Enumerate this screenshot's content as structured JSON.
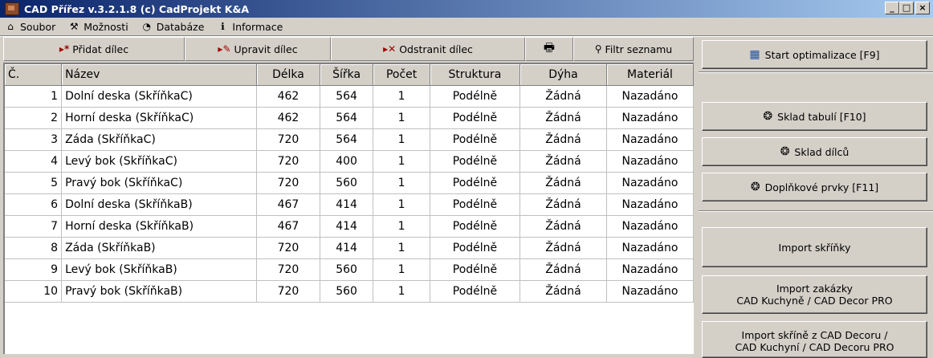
{
  "window": {
    "title": "CAD Přířez v.3.2.1.8  (c) CadProjekt K&A"
  },
  "window_buttons": {
    "minimize": "_",
    "maximize": "□",
    "close": "×"
  },
  "menu": [
    {
      "label": "Soubor",
      "icon": "home-icon",
      "glyph": "⌂"
    },
    {
      "label": "Možnosti",
      "icon": "tools-icon",
      "glyph": "⚒"
    },
    {
      "label": "Databáze",
      "icon": "database-icon",
      "glyph": "◔"
    },
    {
      "label": "Informace",
      "icon": "info-icon",
      "glyph": "ℹ"
    }
  ],
  "toolbar": {
    "add": "Přidat dílec",
    "edit": "Upravit dílec",
    "remove": "Odstranit dílec",
    "print_glyph": "🖶",
    "filter": "Filtr seznamu"
  },
  "table": {
    "headers": [
      "Č.",
      "Název",
      "Délka",
      "Šířka",
      "Počet",
      "Struktura",
      "Dýha",
      "Materiál"
    ],
    "rows": [
      [
        "1",
        "Dolní deska (SkříňkaC)",
        "462",
        "564",
        "1",
        "Podélně",
        "Žádná",
        "Nazadáno"
      ],
      [
        "2",
        "Horní deska (SkříňkaC)",
        "462",
        "564",
        "1",
        "Podélně",
        "Žádná",
        "Nazadáno"
      ],
      [
        "3",
        "Záda (SkříňkaC)",
        "720",
        "564",
        "1",
        "Podélně",
        "Žádná",
        "Nazadáno"
      ],
      [
        "4",
        "Levý bok (SkříňkaC)",
        "720",
        "400",
        "1",
        "Podélně",
        "Žádná",
        "Nazadáno"
      ],
      [
        "5",
        "Pravý bok (SkříňkaC)",
        "720",
        "560",
        "1",
        "Podélně",
        "Žádná",
        "Nazadáno"
      ],
      [
        "6",
        "Dolní deska (SkříňkaB)",
        "467",
        "414",
        "1",
        "Podélně",
        "Žádná",
        "Nazadáno"
      ],
      [
        "7",
        "Horní deska (SkříňkaB)",
        "467",
        "414",
        "1",
        "Podélně",
        "Žádná",
        "Nazadáno"
      ],
      [
        "8",
        "Záda (SkříňkaB)",
        "720",
        "414",
        "1",
        "Podélně",
        "Žádná",
        "Nazadáno"
      ],
      [
        "9",
        "Levý bok (SkříňkaB)",
        "720",
        "560",
        "1",
        "Podélně",
        "Žádná",
        "Nazadáno"
      ],
      [
        "10",
        "Pravý bok (SkříňkaB)",
        "720",
        "560",
        "1",
        "Podélně",
        "Žádná",
        "Nazadáno"
      ]
    ]
  },
  "right_panel": {
    "start": "Start optimalizace [F9]",
    "sheets": "Sklad tabulí [F10]",
    "parts": "Sklad dílců",
    "extras": "Doplňkové prvky [F11]",
    "import_cabinet": "Import skříňky",
    "import_order_1": "Import zakázky",
    "import_order_2": "CAD Kuchyně / CAD Decor PRO",
    "import_decor_1": "Import skříně z CAD Decoru /",
    "import_decor_2": "CAD Kuchyní / CAD Decoru PRO"
  }
}
